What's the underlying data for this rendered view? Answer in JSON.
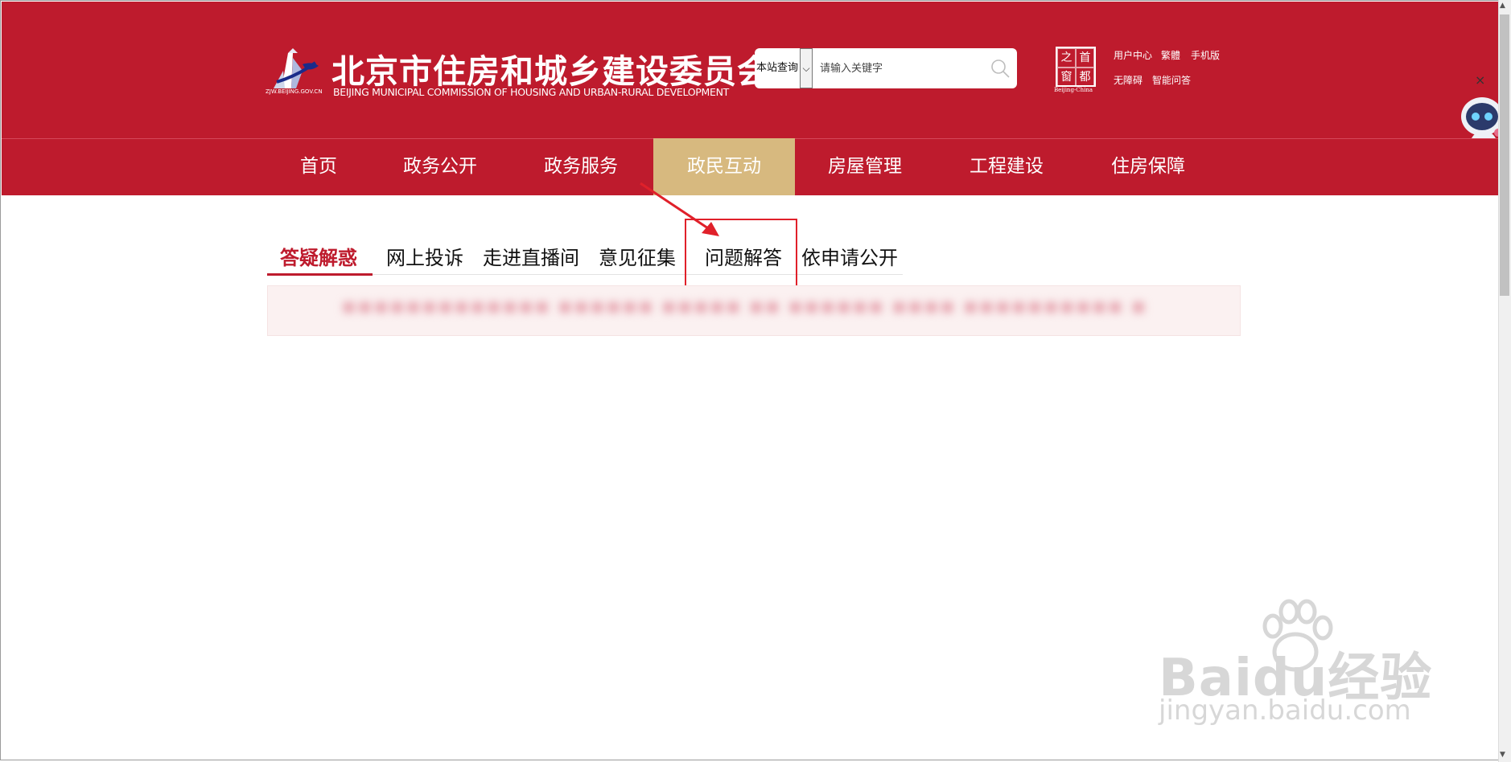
{
  "header": {
    "title": "北京市住房和城乡建设委员会",
    "subtitle": "BEIJING MUNICIPAL COMMISSION OF HOUSING AND URBAN-RURAL DEVELOPMENT",
    "logo_url": "ZJW.BEIJING.GOV.CN",
    "search": {
      "scope": "本站查询",
      "placeholder": "请输入关键字"
    },
    "seal_chars": [
      "之",
      "首",
      "窗",
      "都"
    ],
    "seal_caption": "Beijing-China",
    "links": {
      "user_center": "用户中心",
      "traditional": "繁體",
      "mobile": "手机版",
      "accessibility": "无障碍",
      "smart_qa": "智能问答"
    },
    "close": "×"
  },
  "nav": {
    "items": [
      "首页",
      "政务公开",
      "政务服务",
      "政民互动",
      "房屋管理",
      "工程建设",
      "住房保障"
    ],
    "active": "政民互动"
  },
  "tabs": {
    "items": [
      "答疑解惑",
      "网上投诉",
      "走进直播间",
      "意见征集",
      "问题解答",
      "依申请公开"
    ],
    "active": "答疑解惑",
    "highlighted": "问题解答"
  },
  "notice": {
    "text": "■■■■■■■■■■■■■ ■■■■■■ ■■■■■ ■■ ■■■■■■ ■■■■ ■■■■■■■■■■ ■"
  },
  "watermark": {
    "logo": "Baidu经验",
    "url": "jingyan.baidu.com"
  },
  "colors": {
    "brand_red": "#be1b2d",
    "active_nav": "#d7b97f",
    "annotation_red": "#e0202a"
  }
}
